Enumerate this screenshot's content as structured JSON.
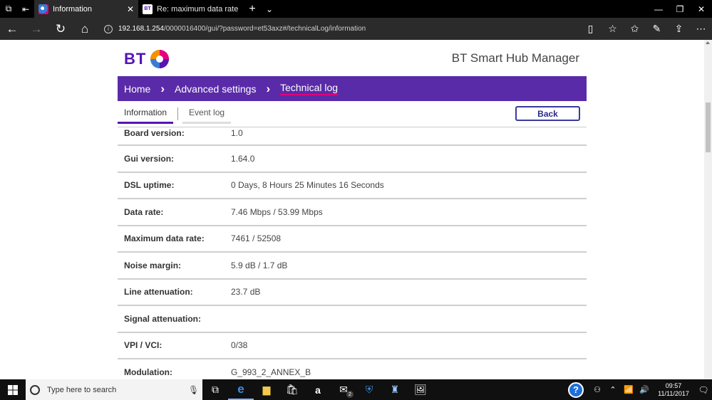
{
  "browser": {
    "tabs": [
      {
        "title": "Information",
        "active": true
      },
      {
        "title": "Re: maximum data rate - Pa",
        "active": false
      }
    ],
    "url_host": "192.168.1.254",
    "url_path": "/0000016400/gui/?password=et53axz#/technicalLog/information"
  },
  "header": {
    "logo_text": "BT",
    "title": "BT Smart Hub Manager"
  },
  "breadcrumb": {
    "items": [
      "Home",
      "Advanced settings",
      "Technical log"
    ]
  },
  "subtabs": {
    "information": "Information",
    "event_log": "Event log"
  },
  "back_button": "Back",
  "rows": [
    {
      "label": "Board version:",
      "value": "1.0"
    },
    {
      "label": "Gui version:",
      "value": "1.64.0"
    },
    {
      "label": "DSL uptime:",
      "value": "0 Days, 8 Hours 25 Minutes 16 Seconds"
    },
    {
      "label": "Data rate:",
      "value": "7.46 Mbps / 53.99 Mbps"
    },
    {
      "label": "Maximum data rate:",
      "value": "7461 / 52508"
    },
    {
      "label": "Noise margin:",
      "value": "5.9 dB / 1.7 dB"
    },
    {
      "label": "Line attenuation:",
      "value": "23.7 dB"
    },
    {
      "label": "Signal attenuation:",
      "value": ""
    },
    {
      "label": "VPI / VCI:",
      "value": "0/38"
    },
    {
      "label": "Modulation:",
      "value": "G_993_2_ANNEX_B"
    }
  ],
  "taskbar": {
    "search_placeholder": "Type here to search",
    "mail_badge": "2",
    "time": "09:57",
    "date": "11/11/2017"
  },
  "colors": {
    "bt_purple": "#5514b4",
    "nav_bar": "#5a2ba8",
    "accent_pink": "#e6007e"
  }
}
